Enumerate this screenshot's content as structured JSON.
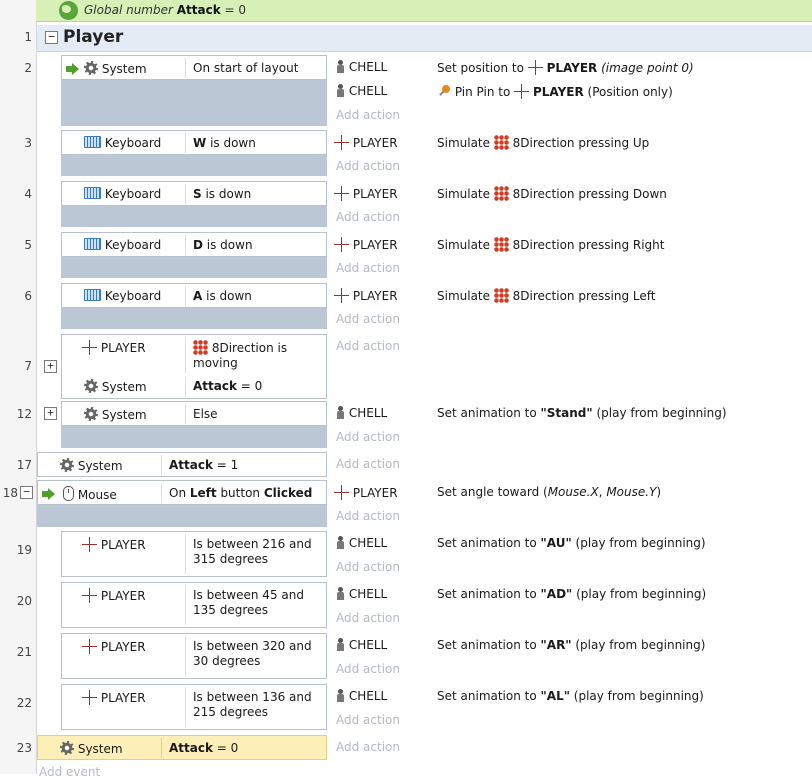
{
  "global_var": {
    "prefix": "Global number",
    "name": "Attack",
    "rest": " = 0"
  },
  "group": {
    "title": "Player",
    "collapse": "−"
  },
  "line_numbers": {
    "l1": "1",
    "l2": "2",
    "l3": "3",
    "l4": "4",
    "l5": "5",
    "l6": "6",
    "l7": "7",
    "l12": "12",
    "l17": "17",
    "l18": "18",
    "l19": "19",
    "l20": "20",
    "l21": "21",
    "l22": "22",
    "l23": "23"
  },
  "add_action": "Add action",
  "add_event": "Add event",
  "e2": {
    "obj": "System",
    "cond": "On start of layout",
    "a1": {
      "obj": "CHELL",
      "t1": "Set position to ",
      "b1": "PLAYER",
      "i1": " (image point 0)"
    },
    "a2": {
      "obj": "CHELL",
      "t1": "Pin Pin to ",
      "b1": "PLAYER",
      "t2": " (Position only)"
    }
  },
  "e3": {
    "obj": "Keyboard",
    "key": "W",
    "cond": " is down",
    "aobj": "PLAYER",
    "t1": "Simulate ",
    "t2": "8Direction pressing Up"
  },
  "e4": {
    "obj": "Keyboard",
    "key": "S",
    "cond": " is down",
    "aobj": "PLAYER",
    "t1": "Simulate ",
    "t2": "8Direction pressing Down"
  },
  "e5": {
    "obj": "Keyboard",
    "key": "D",
    "cond": " is down",
    "aobj": "PLAYER",
    "t1": "Simulate ",
    "t2": "8Direction pressing Right"
  },
  "e6": {
    "obj": "Keyboard",
    "key": "A",
    "cond": " is down",
    "aobj": "PLAYER",
    "t1": "Simulate ",
    "t2": "8Direction pressing Left"
  },
  "e7": {
    "obj1": "PLAYER",
    "cond1": "8Direction is moving",
    "obj2": "System",
    "b2": "Attack",
    "c2": " = 0",
    "expand": "+"
  },
  "e12": {
    "obj": "System",
    "cond": "Else",
    "aobj": "CHELL",
    "t1": "Set animation to ",
    "b1": "\"Stand\"",
    "t2": " (play from beginning)",
    "expand": "+"
  },
  "e17": {
    "obj": "System",
    "b": "Attack",
    "c": " = 1"
  },
  "e18": {
    "obj": "Mouse",
    "t1": "On ",
    "b1": "Left",
    "t2": " button ",
    "b2": "Clicked",
    "aobj": "PLAYER",
    "a1": "Set angle toward (",
    "ai1": "Mouse.X",
    "a2": ", ",
    "ai2": "Mouse.Y",
    "a3": ")",
    "collapse": "−"
  },
  "e19": {
    "obj": "PLAYER",
    "cond": "Is between 216 and 315 degrees",
    "aobj": "CHELL",
    "t1": "Set animation to ",
    "b1": "\"AU\"",
    "t2": " (play from beginning)"
  },
  "e20": {
    "obj": "PLAYER",
    "cond": "Is between 45 and 135 degrees",
    "aobj": "CHELL",
    "t1": "Set animation to ",
    "b1": "\"AD\"",
    "t2": " (play from beginning)"
  },
  "e21": {
    "obj": "PLAYER",
    "cond": "Is between 320 and 30 degrees",
    "aobj": "CHELL",
    "t1": "Set animation to ",
    "b1": "\"AR\"",
    "t2": " (play from beginning)"
  },
  "e22": {
    "obj": "PLAYER",
    "cond": "Is between 136 and 215 degrees",
    "aobj": "CHELL",
    "t1": "Set animation to ",
    "b1": "\"AL\"",
    "t2": " (play from beginning)"
  },
  "e23": {
    "obj": "System",
    "b": "Attack",
    "c": " = 0"
  },
  "colors": {
    "global_bar": "#d6f0b8",
    "group_bar": "#e3ebf5",
    "condition_area": "#bcc7d5",
    "highlight": "#fdefb8",
    "add_text": "#b4bac3"
  },
  "icons": [
    "globe-icon",
    "gear-icon",
    "keyboard-icon",
    "cross-object-icon",
    "chell-sprite-icon",
    "eight-direction-icon",
    "green-arrow-icon",
    "mouse-icon",
    "pin-icon"
  ]
}
